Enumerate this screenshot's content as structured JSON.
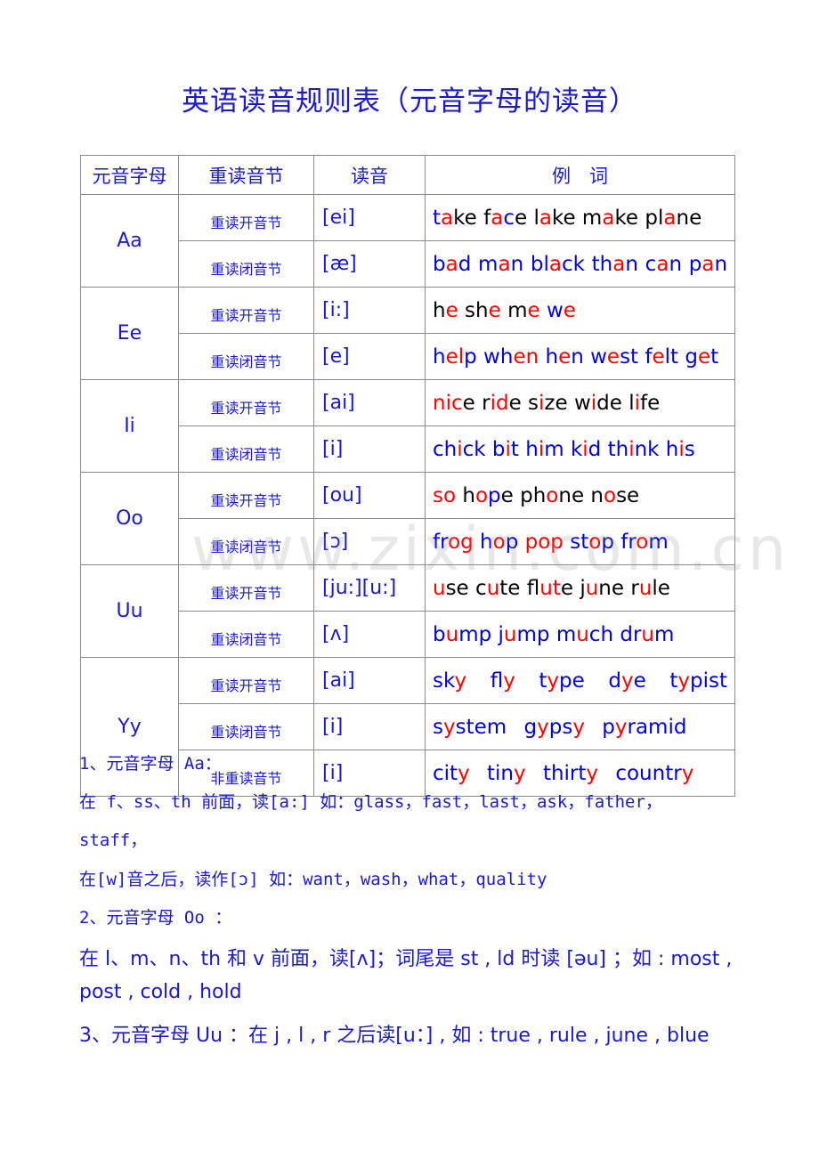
{
  "title": "英语读音规则表（元音字母的读音）",
  "colors": {
    "blue": "#0000dd",
    "red": "#ff0000",
    "black": "#000000",
    "heading": "#1a1acc"
  },
  "table": {
    "headers": [
      "元音字母",
      "重读音节",
      "读音",
      "例　词"
    ],
    "groups": [
      {
        "letter": "Aa",
        "rows": [
          {
            "syllable": "重读开音节",
            "phonetic": "[ei]",
            "words": [
              [
                [
                  "b",
                  "t"
                ],
                [
                  "r",
                  "a"
                ],
                [
                  "k",
                  "ke"
                ]
              ],
              [
                [
                  "k",
                  "f"
                ],
                [
                  "r",
                  "a"
                ],
                [
                  "b",
                  "c"
                ],
                [
                  "k",
                  "e"
                ]
              ],
              [
                [
                  "k",
                  "l"
                ],
                [
                  "r",
                  "a"
                ],
                [
                  "k",
                  "ke"
                ]
              ],
              [
                [
                  "k",
                  "m"
                ],
                [
                  "r",
                  "a"
                ],
                [
                  "k",
                  "ke"
                ]
              ],
              [
                [
                  "k",
                  "pl"
                ],
                [
                  "r",
                  "a"
                ],
                [
                  "k",
                  "ne"
                ]
              ]
            ]
          },
          {
            "syllable": "重读闭音节",
            "phonetic": "[æ]",
            "spread": true,
            "words": [
              [
                [
                  "b",
                  "b"
                ],
                [
                  "r",
                  "a"
                ],
                [
                  "b",
                  "d"
                ]
              ],
              [
                [
                  "b",
                  "m"
                ],
                [
                  "r",
                  "a"
                ],
                [
                  "b",
                  "n"
                ]
              ],
              [
                [
                  "b",
                  "bl"
                ],
                [
                  "r",
                  "a"
                ],
                [
                  "b",
                  "ck"
                ]
              ],
              [
                [
                  "b",
                  "th"
                ],
                [
                  "r",
                  "a"
                ],
                [
                  "b",
                  "n"
                ]
              ],
              [
                [
                  "b",
                  "c"
                ],
                [
                  "r",
                  "a"
                ],
                [
                  "b",
                  "n"
                ]
              ],
              [
                [
                  "b",
                  "p"
                ],
                [
                  "r",
                  "a"
                ],
                [
                  "b",
                  "n"
                ]
              ]
            ]
          }
        ]
      },
      {
        "letter": "Ee",
        "rows": [
          {
            "syllable": "重读开音节",
            "phonetic": "[i:]",
            "words": [
              [
                [
                  "k",
                  "h"
                ],
                [
                  "r",
                  "e"
                ]
              ],
              [
                [
                  "k",
                  "sh"
                ],
                [
                  "r",
                  "e"
                ]
              ],
              [
                [
                  "k",
                  "m"
                ],
                [
                  "r",
                  "e"
                ]
              ],
              [
                [
                  "b",
                  "w"
                ],
                [
                  "r",
                  "e"
                ]
              ]
            ]
          },
          {
            "syllable": "重读闭音节",
            "phonetic": "[e]",
            "words": [
              [
                [
                  "b",
                  "h"
                ],
                [
                  "r",
                  "el"
                ],
                [
                  "b",
                  "p"
                ]
              ],
              [
                [
                  "b",
                  "wh"
                ],
                [
                  "r",
                  "en"
                ]
              ],
              [
                [
                  "b",
                  "h"
                ],
                [
                  "r",
                  "e"
                ],
                [
                  "b",
                  "n"
                ]
              ],
              [
                [
                  "b",
                  "w"
                ],
                [
                  "r",
                  "e"
                ],
                [
                  "b",
                  "st"
                ]
              ],
              [
                [
                  "b",
                  "f"
                ],
                [
                  "r",
                  "e"
                ],
                [
                  "b",
                  "lt"
                ]
              ],
              [
                [
                  "b",
                  "g"
                ],
                [
                  "r",
                  "e"
                ],
                [
                  "b",
                  "t"
                ]
              ]
            ]
          }
        ]
      },
      {
        "letter": "Ii",
        "rows": [
          {
            "syllable": "重读开音节",
            "phonetic": "[ai]",
            "words": [
              [
                [
                  "r",
                  "nic"
                ],
                [
                  "k",
                  "e"
                ]
              ],
              [
                [
                  "k",
                  "r"
                ],
                [
                  "r",
                  "id"
                ],
                [
                  "k",
                  "e"
                ]
              ],
              [
                [
                  "k",
                  "s"
                ],
                [
                  "r",
                  "i"
                ],
                [
                  "k",
                  "ze"
                ]
              ],
              [
                [
                  "k",
                  "w"
                ],
                [
                  "r",
                  "i"
                ],
                [
                  "k",
                  "de"
                ]
              ],
              [
                [
                  "k",
                  "l"
                ],
                [
                  "r",
                  "i"
                ],
                [
                  "k",
                  "fe"
                ]
              ]
            ]
          },
          {
            "syllable": "重读闭音节",
            "phonetic": "[i]",
            "words": [
              [
                [
                  "b",
                  "ch"
                ],
                [
                  "r",
                  "i"
                ],
                [
                  "b",
                  "ck"
                ]
              ],
              [
                [
                  "b",
                  "b"
                ],
                [
                  "r",
                  "i"
                ],
                [
                  "b",
                  "t"
                ]
              ],
              [
                [
                  "b",
                  "h"
                ],
                [
                  "r",
                  "i"
                ],
                [
                  "b",
                  "m"
                ]
              ],
              [
                [
                  "b",
                  "k"
                ],
                [
                  "r",
                  "i"
                ],
                [
                  "b",
                  "d"
                ]
              ],
              [
                [
                  "b",
                  "th"
                ],
                [
                  "r",
                  "i"
                ],
                [
                  "b",
                  "nk"
                ]
              ],
              [
                [
                  "b",
                  "h"
                ],
                [
                  "r",
                  "i"
                ],
                [
                  "b",
                  "s"
                ]
              ]
            ]
          }
        ]
      },
      {
        "letter": "Oo",
        "rows": [
          {
            "syllable": "重读开音节",
            "phonetic": "[ou]",
            "words": [
              [
                [
                  "r",
                  "so"
                ]
              ],
              [
                [
                  "k",
                  "h"
                ],
                [
                  "r",
                  "o"
                ],
                [
                  "b",
                  "p"
                ],
                [
                  "k",
                  "e"
                ]
              ],
              [
                [
                  "k",
                  "ph"
                ],
                [
                  "r",
                  "o"
                ],
                [
                  "k",
                  "ne"
                ]
              ],
              [
                [
                  "k",
                  "n"
                ],
                [
                  "r",
                  "o"
                ],
                [
                  "k",
                  "se"
                ]
              ]
            ]
          },
          {
            "syllable": "重读闭音节",
            "phonetic": "[ɔ]",
            "words": [
              [
                [
                  "b",
                  "fr"
                ],
                [
                  "r",
                  "og"
                ]
              ],
              [
                [
                  "b",
                  "h"
                ],
                [
                  "r",
                  "o"
                ],
                [
                  "b",
                  "p"
                ]
              ],
              [
                [
                  "r",
                  "pop"
                ]
              ],
              [
                [
                  "b",
                  "st"
                ],
                [
                  "r",
                  "o"
                ],
                [
                  "b",
                  "p"
                ]
              ],
              [
                [
                  "b",
                  "fr"
                ],
                [
                  "r",
                  "o"
                ],
                [
                  "b",
                  "m"
                ]
              ]
            ]
          }
        ]
      },
      {
        "letter": "Uu",
        "rows": [
          {
            "syllable": "重读开音节",
            "phonetic": "[ju:][u:]",
            "words": [
              [
                [
                  "r",
                  "u"
                ],
                [
                  "k",
                  "se"
                ]
              ],
              [
                [
                  "k",
                  "c"
                ],
                [
                  "r",
                  "u"
                ],
                [
                  "k",
                  "te"
                ]
              ],
              [
                [
                  "k",
                  "fl"
                ],
                [
                  "r",
                  "ut"
                ],
                [
                  "k",
                  "e"
                ]
              ],
              [
                [
                  "k",
                  "j"
                ],
                [
                  "r",
                  "u"
                ],
                [
                  "k",
                  "ne"
                ]
              ],
              [
                [
                  "k",
                  "r"
                ],
                [
                  "r",
                  "u"
                ],
                [
                  "k",
                  "le"
                ]
              ]
            ]
          },
          {
            "syllable": "重读闭音节",
            "phonetic": "[ʌ]",
            "words": [
              [
                [
                  "b",
                  "b"
                ],
                [
                  "r",
                  "u"
                ],
                [
                  "b",
                  "mp"
                ]
              ],
              [
                [
                  "b",
                  "j"
                ],
                [
                  "r",
                  "u"
                ],
                [
                  "b",
                  "mp"
                ]
              ],
              [
                [
                  "b",
                  "m"
                ],
                [
                  "r",
                  "u"
                ],
                [
                  "b",
                  "ch"
                ]
              ],
              [
                [
                  "b",
                  "dr"
                ],
                [
                  "r",
                  "u"
                ],
                [
                  "b",
                  "m"
                ]
              ]
            ]
          }
        ]
      },
      {
        "letter": "Yy",
        "rows": [
          {
            "syllable": "重读开音节",
            "phonetic": "[ai]",
            "spread": true,
            "words": [
              [
                [
                  "b",
                  "sk"
                ],
                [
                  "r",
                  "y"
                ]
              ],
              [
                [
                  "b",
                  "fl"
                ],
                [
                  "r",
                  "y"
                ]
              ],
              [
                [
                  "b",
                  "t"
                ],
                [
                  "r",
                  "y"
                ],
                [
                  "b",
                  "pe"
                ]
              ],
              [
                [
                  "b",
                  "d"
                ],
                [
                  "r",
                  "y"
                ],
                [
                  "b",
                  "e"
                ]
              ],
              [
                [
                  "b",
                  "t"
                ],
                [
                  "r",
                  "y"
                ],
                [
                  "b",
                  "pist"
                ]
              ]
            ]
          },
          {
            "syllable": "重读闭音节",
            "phonetic": "[i]",
            "wide": true,
            "words": [
              [
                [
                  "b",
                  "s"
                ],
                [
                  "r",
                  "y"
                ],
                [
                  "b",
                  "stem"
                ]
              ],
              [
                [
                  "b",
                  "g"
                ],
                [
                  "r",
                  "y"
                ],
                [
                  "b",
                  "ps"
                ],
                [
                  "r",
                  "y"
                ]
              ],
              [
                [
                  "b",
                  "p"
                ],
                [
                  "r",
                  "y"
                ],
                [
                  "b",
                  "ramid"
                ]
              ]
            ]
          },
          {
            "syllable": "非重读音节",
            "phonetic": "[i]",
            "wide": true,
            "words": [
              [
                [
                  "b",
                  "cit"
                ],
                [
                  "r",
                  "y"
                ]
              ],
              [
                [
                  "b",
                  "tin"
                ],
                [
                  "r",
                  "y"
                ]
              ],
              [
                [
                  "b",
                  "thirt"
                ],
                [
                  "r",
                  "y"
                ]
              ],
              [
                [
                  "b",
                  "countr"
                ],
                [
                  "r",
                  "y"
                ]
              ]
            ]
          }
        ]
      }
    ]
  },
  "notes": [
    {
      "style": "mono",
      "text": "1、元音字母 Aa："
    },
    {
      "style": "mono",
      "text": "在 f、ss、th 前面，读[a:] 如：glass，fast，last，ask，father，"
    },
    {
      "style": "mono",
      "text": "staff，"
    },
    {
      "style": "mono",
      "text": "在[w]音之后，读作[ɔ] 如：want，wash，what，quality"
    },
    {
      "style": "mono",
      "text": "2、元音字母 Oo ："
    },
    {
      "style": "sans",
      "text": "在 l、m、n、th 和 v 前面，读[ʌ]；词尾是 st , ld 时读 [əu] ；如 : most ,"
    },
    {
      "style": "sans",
      "text": "post , cold , hold"
    },
    {
      "style": "sans",
      "text": "3、元音字母 Uu ：在 j , l , r 之后读[u：] , 如 : true , rule , june , blue"
    }
  ],
  "watermark": "www.zixin.com.cn"
}
